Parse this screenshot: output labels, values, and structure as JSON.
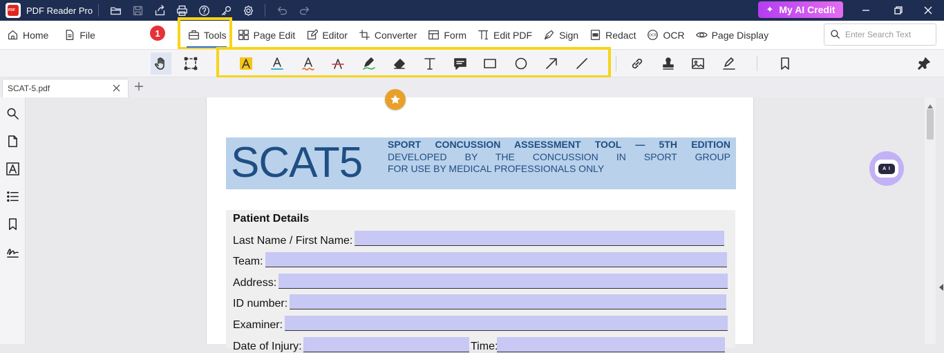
{
  "titlebar": {
    "app_name": "PDF Reader Pro",
    "ai_credit_label": "My AI Credit",
    "icons": [
      "open-folder-icon",
      "save-icon",
      "share-icon",
      "print-icon",
      "help-icon",
      "key-icon",
      "settings-icon",
      "undo-icon",
      "redo-icon"
    ]
  },
  "menubar": {
    "home": "Home",
    "file": "File",
    "badge": "1",
    "tools": "Tools",
    "page_edit": "Page Edit",
    "editor": "Editor",
    "converter": "Converter",
    "form": "Form",
    "edit_pdf": "Edit PDF",
    "sign": "Sign",
    "redact": "Redact",
    "ocr": "OCR",
    "page_display": "Page Display",
    "search_placeholder": "Enter Search Text"
  },
  "toolbar": {
    "tools": [
      "hand-tool",
      "area-select-tool",
      "highlight-text-tool",
      "underline-text-tool",
      "squiggly-text-tool",
      "strikethrough-text-tool",
      "freehand-pen-tool",
      "eraser-tool",
      "text-box-tool",
      "note-tool",
      "rectangle-tool",
      "circle-tool",
      "arrow-tool",
      "line-tool",
      "link-tool",
      "stamp-tool",
      "image-tool",
      "signature-tool",
      "bookmark-tool",
      "pin-tool"
    ]
  },
  "tabs": {
    "active_doc": "SCAT-5.pdf"
  },
  "document": {
    "logo": "SCAT5",
    "heading": "SPORT CONCUSSION ASSESSMENT TOOL — 5TH EDITION",
    "subheading": "DEVELOPED BY THE CONCUSSION IN SPORT GROUP",
    "subheading2": "FOR USE BY MEDICAL PROFESSIONALS ONLY",
    "patient_title": "Patient Details",
    "fields": [
      "Last Name / First Name:",
      "Team:",
      "Address:",
      "ID number:",
      "Examiner:",
      "Date of Injury:",
      "Time:"
    ]
  },
  "colors": {
    "titlebar_bg": "#1e2d52",
    "highlight_box": "#f7d51b",
    "banner_bg": "#b9d1ea",
    "banner_text": "#1f4e84",
    "form_field_fill": "#c8c8f4",
    "badge_red": "#e53238",
    "accent_blue": "#2b6ed6"
  }
}
